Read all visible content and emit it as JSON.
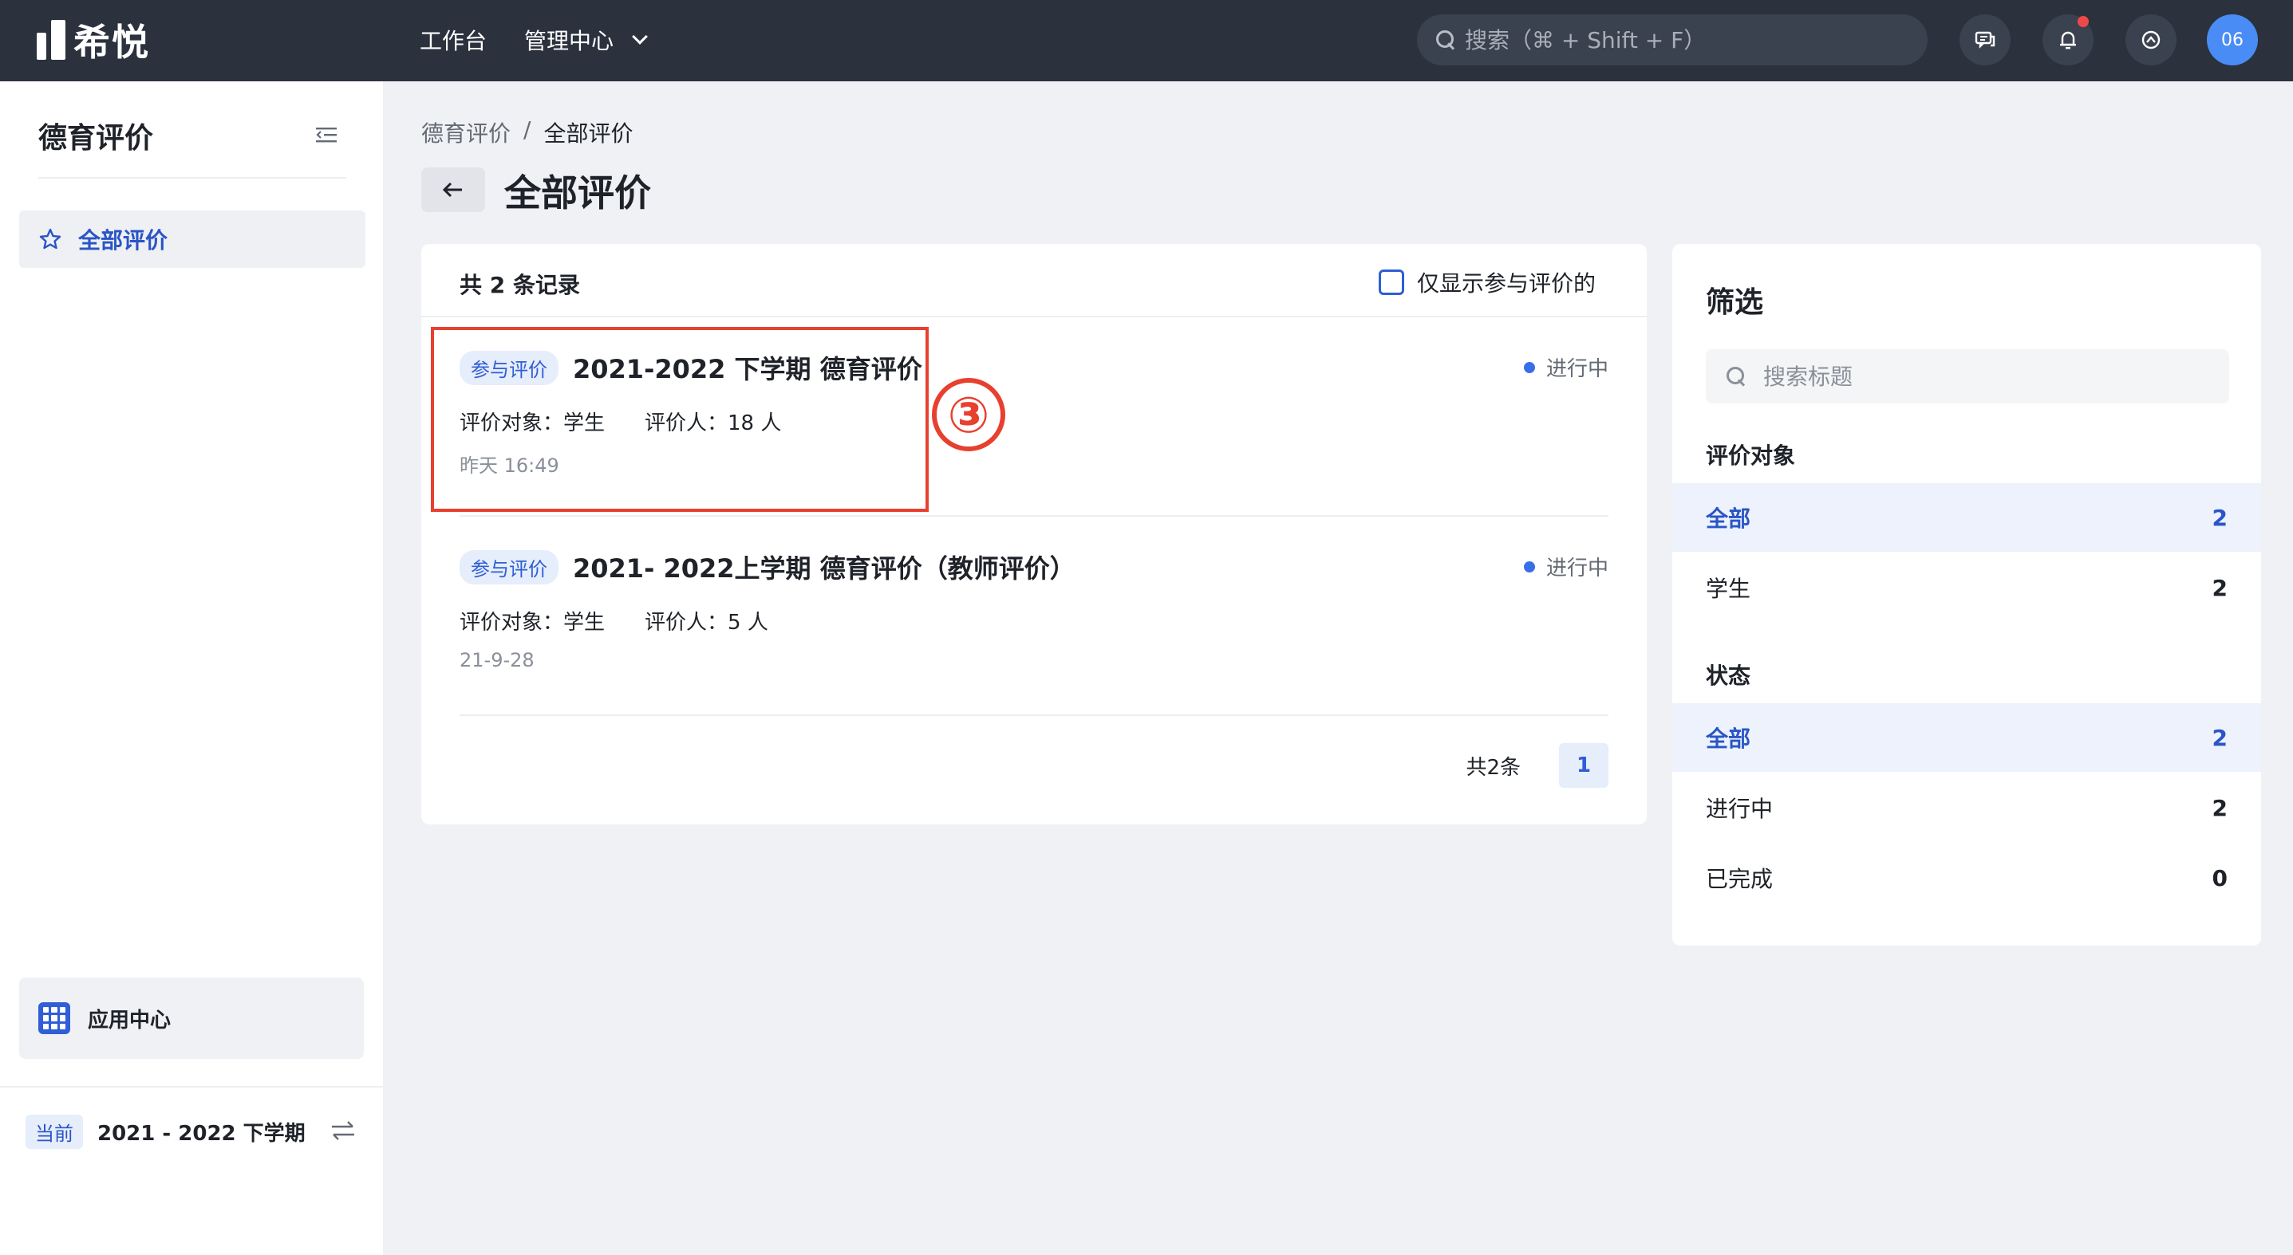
{
  "topbar": {
    "brand": "希悦",
    "nav": [
      {
        "label": "工作台"
      },
      {
        "label": "管理中心"
      }
    ],
    "search_placeholder": "搜索（⌘ + Shift + F）",
    "avatar": "06",
    "colors": {
      "bg": "#2b313d",
      "avatar": "#4a8cf5",
      "notify_dot": "#f04848"
    }
  },
  "sidebar": {
    "title": "德育评价",
    "items": [
      {
        "label": "全部评价",
        "icon": "star-icon"
      }
    ],
    "app_center": "应用中心",
    "term": {
      "tag": "当前",
      "value": "2021 - 2022 下学期"
    }
  },
  "main": {
    "breadcrumb": [
      "德育评价",
      "/",
      "全部评价"
    ],
    "title": "全部评价",
    "total": "共 2 条记录",
    "only_mine": "仅显示参与评价的",
    "records": [
      {
        "tag": "参与评价",
        "title": "2021-2022 下学期 德育评价",
        "target": "评价对象：学生",
        "evaluators": "评价人：18 人",
        "time": "昨天 16:49",
        "status": "进行中"
      },
      {
        "tag": "参与评价",
        "title": "2021- 2022上学期 德育评价（教师评价）",
        "target": "评价对象：学生",
        "evaluators": "评价人：5 人",
        "time": "21-9-28",
        "status": "进行中"
      }
    ],
    "annotation": "③",
    "pager": {
      "count": "共2条",
      "page": "1"
    }
  },
  "filter": {
    "title": "筛选",
    "search_placeholder": "搜索标题",
    "groups": [
      {
        "title": "评价对象",
        "options": [
          {
            "label": "全部",
            "count": "2",
            "active": true
          },
          {
            "label": "学生",
            "count": "2",
            "active": false
          }
        ]
      },
      {
        "title": "状态",
        "options": [
          {
            "label": "全部",
            "count": "2",
            "active": true
          },
          {
            "label": "进行中",
            "count": "2",
            "active": false
          },
          {
            "label": "已完成",
            "count": "0",
            "active": false
          }
        ]
      }
    ]
  },
  "accent_colors": {
    "primary": "#2f5ed6",
    "annotation_red": "#e8402f"
  }
}
